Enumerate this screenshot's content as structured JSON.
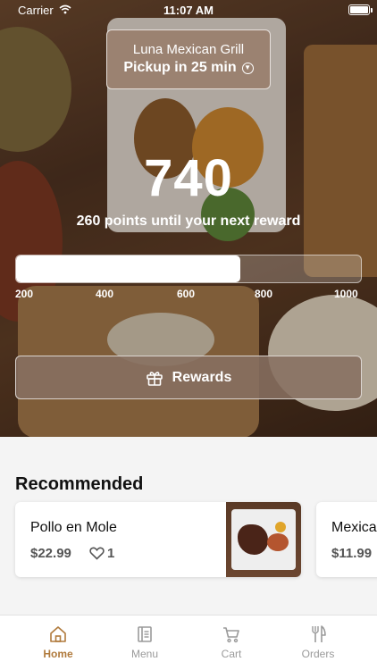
{
  "status_bar": {
    "carrier": "Carrier",
    "time": "11:07 AM"
  },
  "location": {
    "name": "Luna Mexican Grill",
    "pickup": "Pickup in 25 min"
  },
  "rewards": {
    "points": "740",
    "subtitle": "260 points until your next reward",
    "progress_fraction": 0.65,
    "ticks": [
      "200",
      "400",
      "600",
      "800",
      "1000"
    ],
    "button_label": "Rewards"
  },
  "recommended": {
    "title": "Recommended",
    "items": [
      {
        "name": "Pollo en Mole",
        "price": "$22.99",
        "likes": "1"
      },
      {
        "name": "Mexica",
        "price": "$11.99"
      }
    ]
  },
  "tabbar": {
    "tabs": [
      {
        "label": "Home",
        "icon": "home-icon",
        "active": true
      },
      {
        "label": "Menu",
        "icon": "menu-icon",
        "active": false
      },
      {
        "label": "Cart",
        "icon": "cart-icon",
        "active": false
      },
      {
        "label": "Orders",
        "icon": "fork-knife-icon",
        "active": false
      }
    ]
  },
  "colors": {
    "accent": "#b07a3c",
    "inactive": "#9a9a9a"
  }
}
